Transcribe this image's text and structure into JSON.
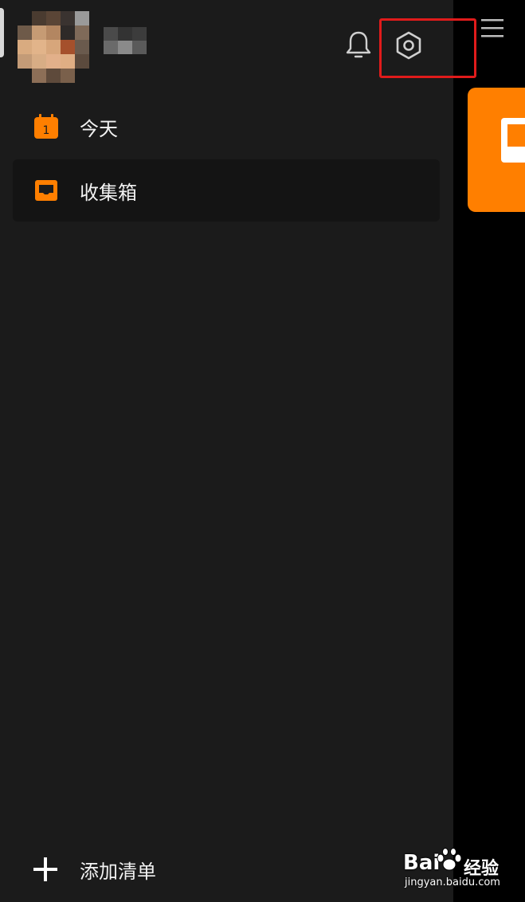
{
  "header": {
    "notification_icon": "bell-icon",
    "settings_icon": "settings-hexagon-icon",
    "menu_icon": "hamburger-icon",
    "highlight_color": "#e01b1b"
  },
  "nav": {
    "items": [
      {
        "label": "今天",
        "icon": "calendar-icon",
        "badge": "1",
        "active": false
      },
      {
        "label": "收集箱",
        "icon": "inbox-icon",
        "active": true
      }
    ]
  },
  "footer": {
    "add_list_label": "添加清单",
    "add_icon": "plus-icon"
  },
  "theme": {
    "accent": "#ff7f00",
    "drawer_bg": "#1b1b1b",
    "text": "#f2f2f2"
  },
  "watermark": {
    "brand_text": "Bai",
    "brand_suffix": "经验",
    "url": "jingyan.baidu.com"
  }
}
